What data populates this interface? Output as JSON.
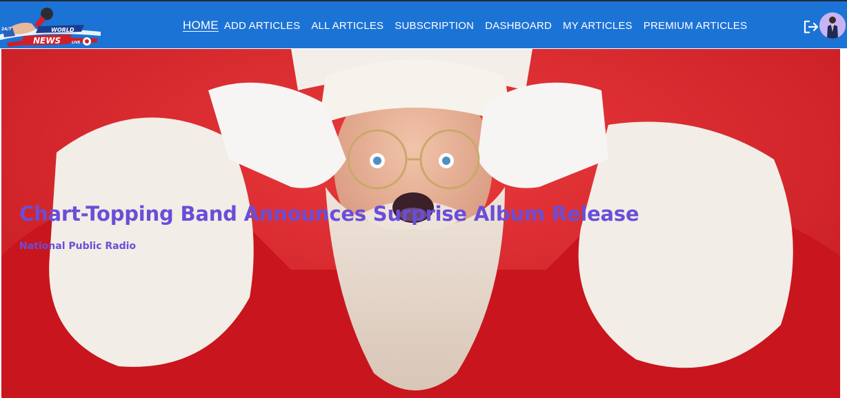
{
  "logo": {
    "top_text": "24/7",
    "world_text": "WORLD",
    "news_text": "NEWS",
    "live_text": "LIVE"
  },
  "nav": {
    "links": [
      {
        "label": "HOME",
        "active": true
      },
      {
        "label": "ADD ARTICLES"
      },
      {
        "label": "ALL ARTICLES"
      },
      {
        "label": "SUBSCRIPTION"
      },
      {
        "label": "DASHBOARD"
      },
      {
        "label": "MY ARTICLES"
      },
      {
        "label": "PREMIUM ARTICLES"
      }
    ],
    "logout_icon": "logout-icon",
    "avatar_icon": "user-avatar"
  },
  "hero": {
    "title": "Chart-Topping Band Announces Surprise Album Release",
    "source": "National Public Radio",
    "image": "surprised-santa-claus-photo"
  },
  "colors": {
    "navbar": "#1c73d6",
    "title": "#6a4ed8",
    "hero_bg": "#d32026"
  }
}
